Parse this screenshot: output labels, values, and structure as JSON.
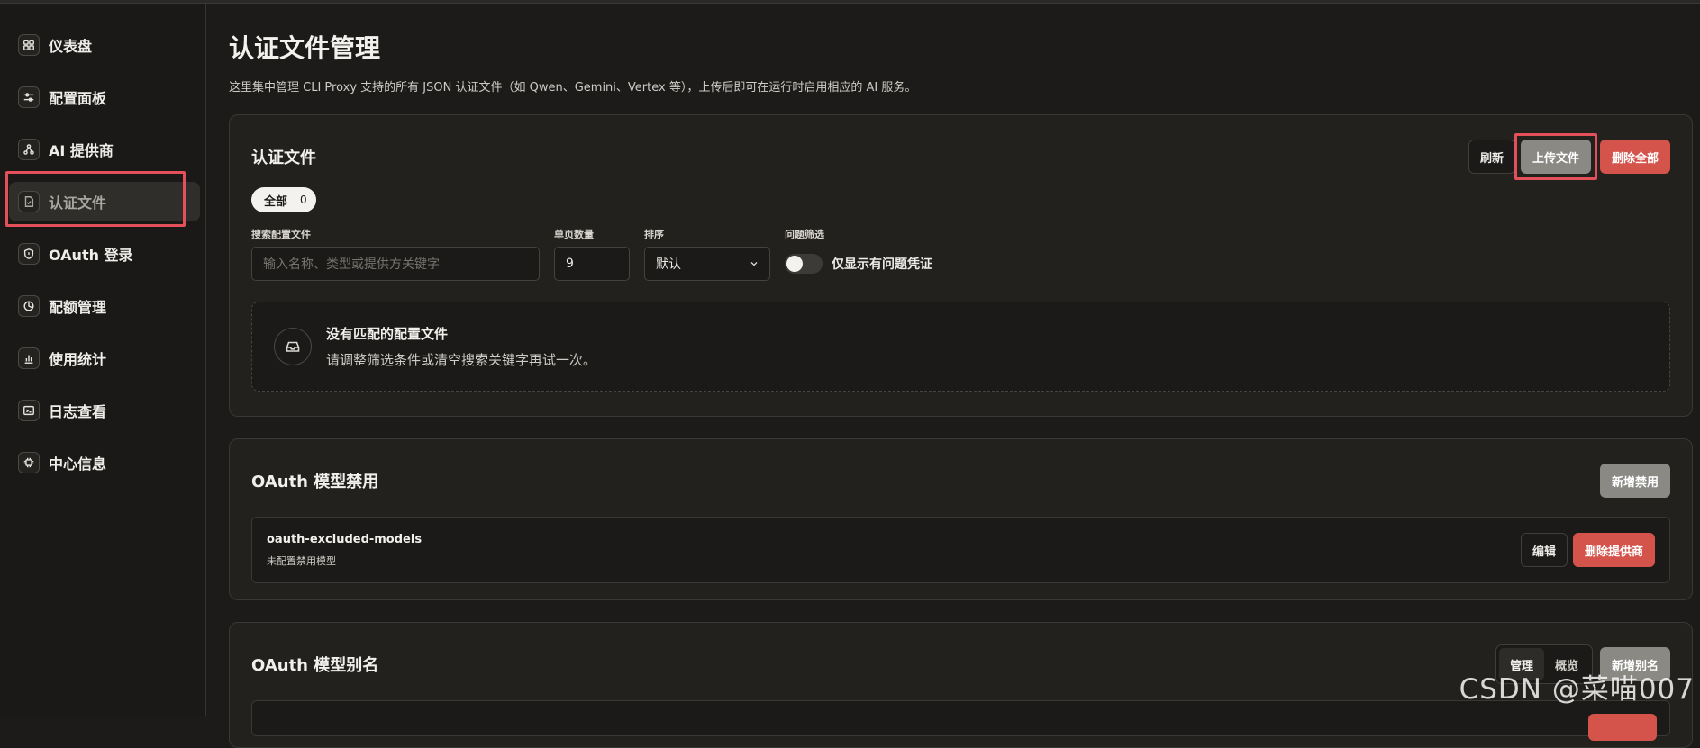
{
  "sidebar": {
    "items": [
      {
        "label": "仪表盘",
        "icon": "dashboard-icon"
      },
      {
        "label": "配置面板",
        "icon": "sliders-icon"
      },
      {
        "label": "AI 提供商",
        "icon": "network-icon"
      },
      {
        "label": "认证文件",
        "icon": "file-check-icon",
        "active": true
      },
      {
        "label": "OAuth 登录",
        "icon": "shield-icon"
      },
      {
        "label": "配额管理",
        "icon": "pie-chart-icon"
      },
      {
        "label": "使用统计",
        "icon": "bar-chart-icon"
      },
      {
        "label": "日志查看",
        "icon": "terminal-icon"
      },
      {
        "label": "中心信息",
        "icon": "chip-icon"
      }
    ]
  },
  "page": {
    "title": "认证文件管理",
    "description": "这里集中管理 CLI Proxy 支持的所有 JSON 认证文件（如 Qwen、Gemini、Vertex 等），上传后即可在运行时启用相应的 AI 服务。"
  },
  "auth_card": {
    "title": "认证文件",
    "refresh_label": "刷新",
    "upload_label": "上传文件",
    "delete_all_label": "删除全部",
    "filter_pill": {
      "label": "全部",
      "count": "0"
    },
    "search": {
      "label": "搜索配置文件",
      "placeholder": "输入名称、类型或提供方关键字"
    },
    "page_size": {
      "label": "单页数量",
      "value": "9"
    },
    "sort": {
      "label": "排序",
      "value": "默认"
    },
    "issue_filter": {
      "label": "问题筛选",
      "toggle_label": "仅显示有问题凭证",
      "on": false
    },
    "empty": {
      "title": "没有匹配的配置文件",
      "text": "请调整筛选条件或清空搜索关键字再试一次。"
    }
  },
  "excluded_card": {
    "title": "OAuth 模型禁用",
    "add_label": "新增禁用",
    "row": {
      "name": "oauth-excluded-models",
      "sub": "未配置禁用模型",
      "edit_label": "编辑",
      "delete_label": "删除提供商"
    }
  },
  "alias_card": {
    "title": "OAuth 模型别名",
    "seg": [
      "管理",
      "概览"
    ],
    "add_label": "新增别名"
  },
  "watermark": "CSDN @菜喵007",
  "colors": {
    "background": "#1c1b19",
    "card": "#22211e",
    "danger": "#d4534a",
    "highlight": "#e4505a"
  }
}
